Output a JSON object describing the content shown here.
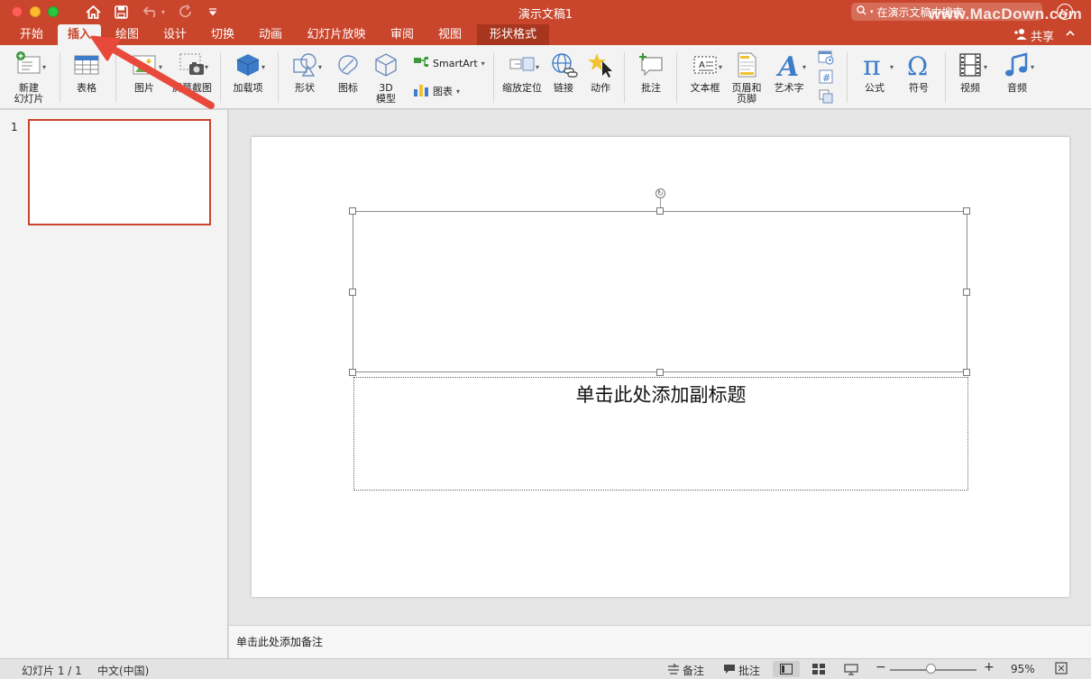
{
  "window": {
    "title": "演示文稿1"
  },
  "search": {
    "placeholder": "在演示文稿中搜索"
  },
  "watermark": "www.MacDown.com",
  "tabs": [
    {
      "label": "开始"
    },
    {
      "label": "插入"
    },
    {
      "label": "绘图"
    },
    {
      "label": "设计"
    },
    {
      "label": "切换"
    },
    {
      "label": "动画"
    },
    {
      "label": "幻灯片放映"
    },
    {
      "label": "审阅"
    },
    {
      "label": "视图"
    },
    {
      "label": "形状格式"
    }
  ],
  "share_label": "共享",
  "ribbon": {
    "new_slide": "新建\n幻灯片",
    "table": "表格",
    "picture": "图片",
    "screenshot": "屏幕截图",
    "addins": "加载项",
    "shapes": "形状",
    "icons": "图标",
    "model3d": "3D\n模型",
    "smartart": "SmartArt",
    "chart": "图表",
    "zoom": "缩放定位",
    "link": "链接",
    "action": "动作",
    "comment": "批注",
    "textbox": "文本框",
    "header_footer": "页眉和\n页脚",
    "wordart": "艺术字",
    "equation": "公式",
    "symbol": "符号",
    "video": "视频",
    "audio": "音频"
  },
  "thumbnail": {
    "number": "1"
  },
  "slide": {
    "subtitle_placeholder": "单击此处添加副标题"
  },
  "notes": {
    "placeholder": "单击此处添加备注"
  },
  "status": {
    "slide_count": "幻灯片 1 / 1",
    "language": "中文(中国)",
    "notes_btn": "备注",
    "comments_btn": "批注",
    "zoom_level": "95%"
  },
  "colors": {
    "accent": "#c9452b",
    "annotation": "#e8493a"
  }
}
